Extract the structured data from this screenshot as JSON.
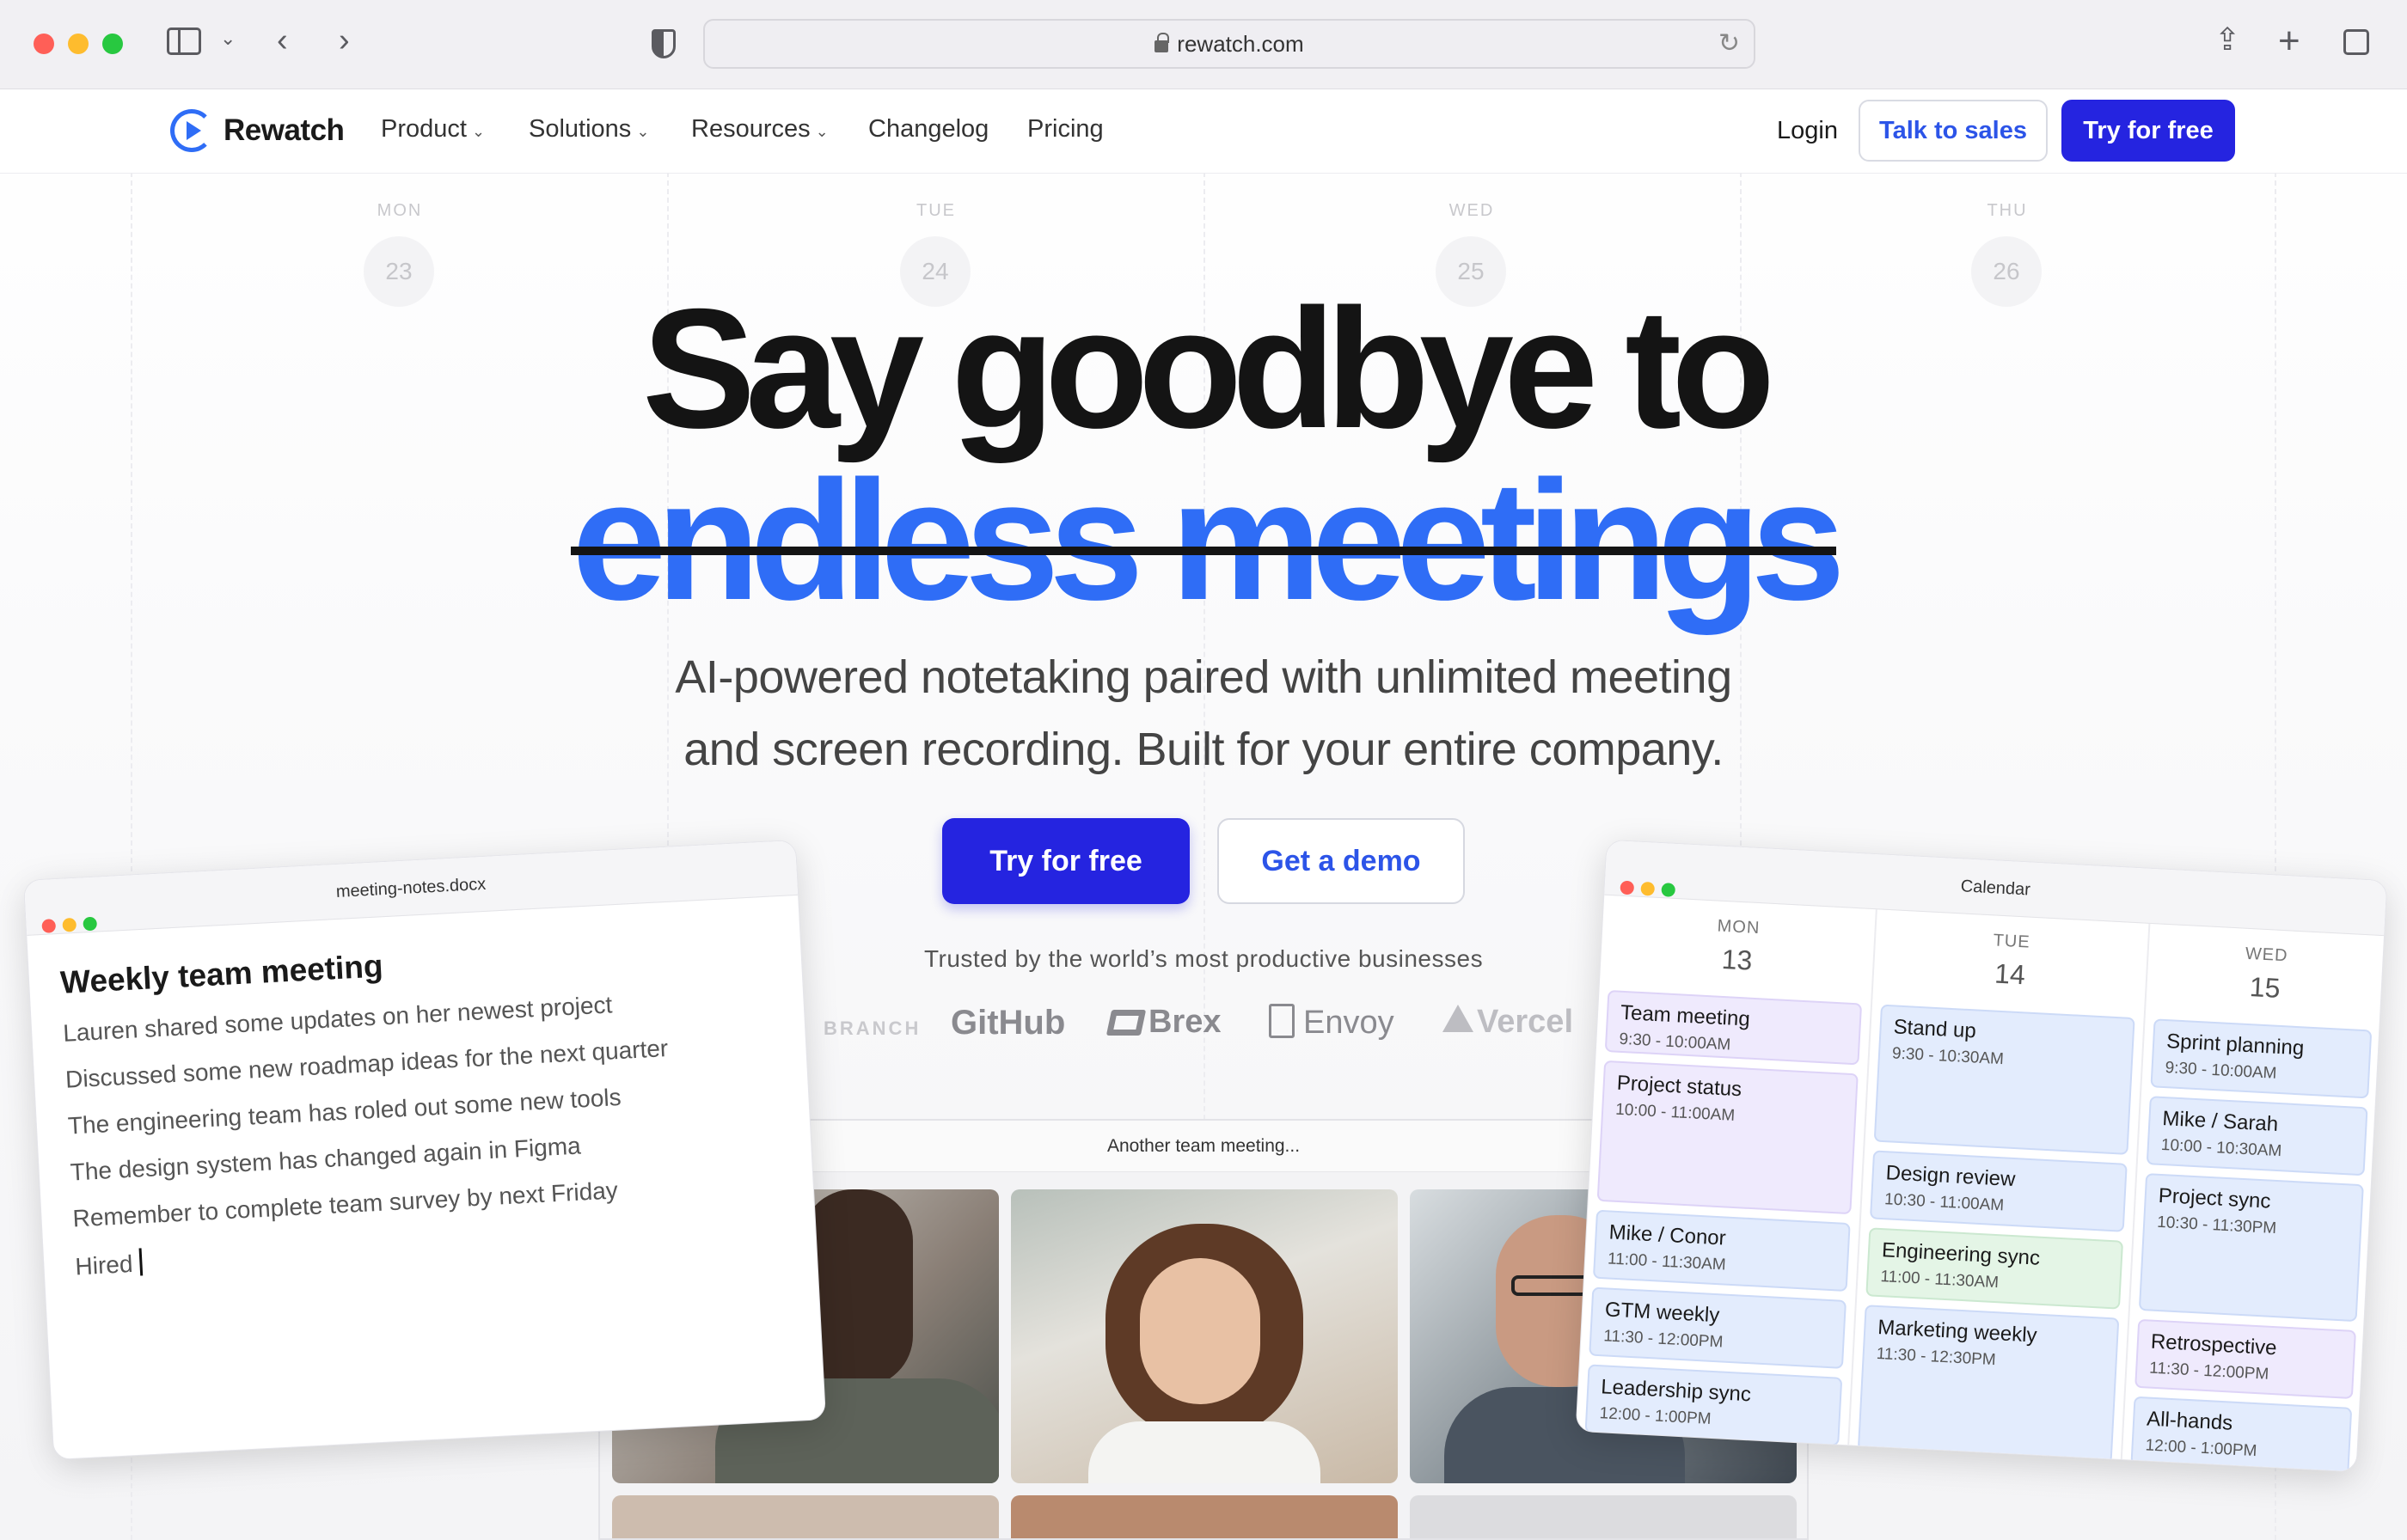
{
  "browser": {
    "url": "rewatch.com"
  },
  "nav": {
    "brand": "Rewatch",
    "links": [
      "Product",
      "Solutions",
      "Resources",
      "Changelog",
      "Pricing"
    ],
    "login": "Login",
    "talk_to_sales": "Talk to sales",
    "try_free": "Try for free"
  },
  "calendar_bg": {
    "days": [
      {
        "name": "MON",
        "num": "23"
      },
      {
        "name": "TUE",
        "num": "24"
      },
      {
        "name": "WED",
        "num": "25"
      },
      {
        "name": "THU",
        "num": "26"
      }
    ]
  },
  "hero": {
    "line1": "Say goodbye to",
    "line2": "endless meetings",
    "sub1": "AI-powered notetaking paired with unlimited meeting",
    "sub2": "and screen recording. Built for your entire company.",
    "cta_primary": "Try for free",
    "cta_secondary": "Get a demo",
    "trusted": "Trusted by the world’s most productive businesses",
    "logos": [
      "BRANCH",
      "GitHub",
      "Brex",
      "Envoy",
      "Vercel"
    ]
  },
  "video_window": {
    "title": "Another team meeting..."
  },
  "notes_window": {
    "filename": "meeting-notes.docx",
    "heading": "Weekly team meeting",
    "lines": [
      "Lauren shared some updates on her newest project",
      "Discussed some new roadmap ideas for the next quarter",
      "The engineering team has roled out some new tools",
      "The design system has changed again in Figma",
      "Remember to complete team survey by next Friday",
      "Hired"
    ]
  },
  "calendar_window": {
    "title": "Calendar",
    "columns": [
      {
        "day": "MON",
        "num": "13",
        "events": [
          {
            "title": "Team meeting",
            "time": "9:30 - 10:00AM"
          },
          {
            "title": "Project status",
            "time": "10:00 - 11:00AM"
          },
          {
            "title": "Mike / Conor",
            "time": "11:00 - 11:30AM"
          },
          {
            "title": "GTM weekly",
            "time": "11:30 - 12:00PM"
          },
          {
            "title": "Leadership sync",
            "time": "12:00 - 1:00PM"
          }
        ]
      },
      {
        "day": "TUE",
        "num": "14",
        "events": [
          {
            "title": "Stand up",
            "time": "9:30 - 10:30AM"
          },
          {
            "title": "Design review",
            "time": "10:30 - 11:00AM"
          },
          {
            "title": "Engineering sync",
            "time": "11:00 - 11:30AM"
          },
          {
            "title": "Marketing weekly",
            "time": "11:30 - 12:30PM"
          }
        ]
      },
      {
        "day": "WED",
        "num": "15",
        "events": [
          {
            "title": "Sprint planning",
            "time": "9:30 - 10:00AM"
          },
          {
            "title": "Mike / Sarah",
            "time": "10:00 - 10:30AM"
          },
          {
            "title": "Project sync",
            "time": "10:30 - 11:30PM"
          },
          {
            "title": "Retrospective",
            "time": "11:30 - 12:00PM"
          },
          {
            "title": "All-hands",
            "time": "12:00 - 1:00PM"
          }
        ]
      }
    ]
  }
}
